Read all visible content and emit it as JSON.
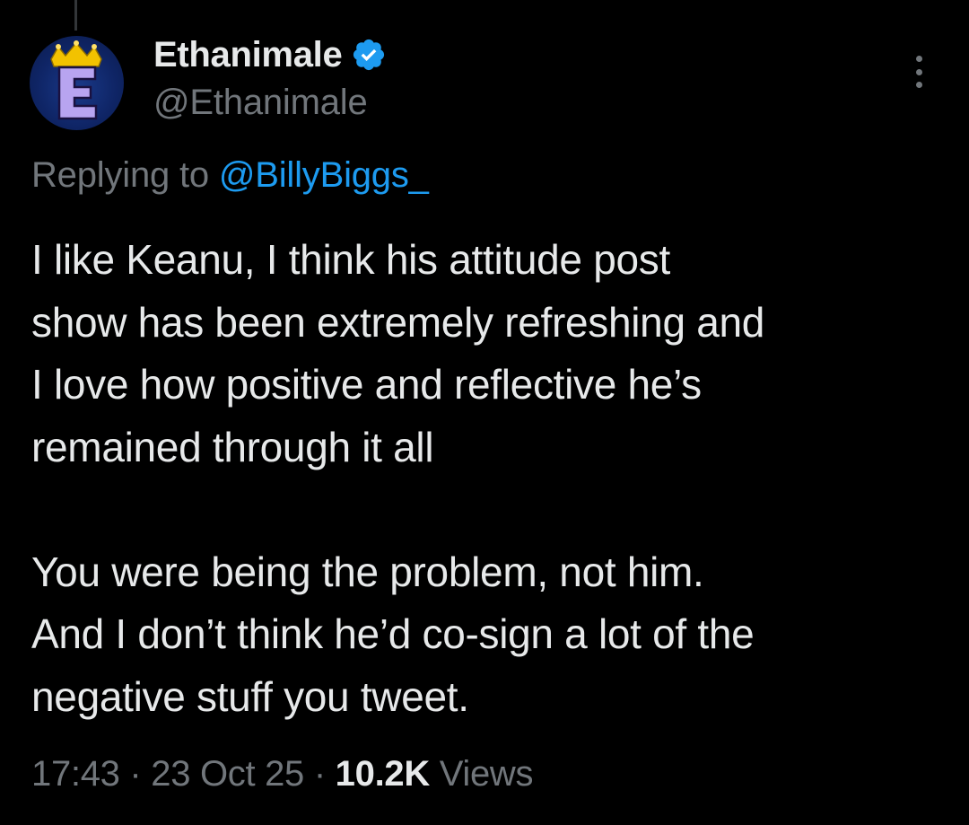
{
  "author": {
    "display_name": "Ethanimale",
    "handle": "@Ethanimale",
    "verified": true,
    "avatar_letter": "E",
    "avatar_icon": "crown-icon"
  },
  "reply": {
    "prefix": "Replying to ",
    "mention": "@BillyBiggs_"
  },
  "tweet": {
    "paragraph_1": "I like Keanu, I think his attitude post\nshow has been extremely refreshing and\nI love how positive and reflective he’s\nremained through it all",
    "paragraph_2": "You were being the problem, not him.\nAnd I don’t think he’d co-sign a lot of the\nnegative stuff you tweet."
  },
  "meta": {
    "time": "17:43",
    "separator_1": " · ",
    "date": "23 Oct 25",
    "separator_2": " · ",
    "views_count": "10.2K",
    "views_label": " Views"
  },
  "colors": {
    "background": "#000000",
    "primary_text": "#e7e9ea",
    "secondary_text": "#71767b",
    "accent": "#1d9bf0"
  }
}
